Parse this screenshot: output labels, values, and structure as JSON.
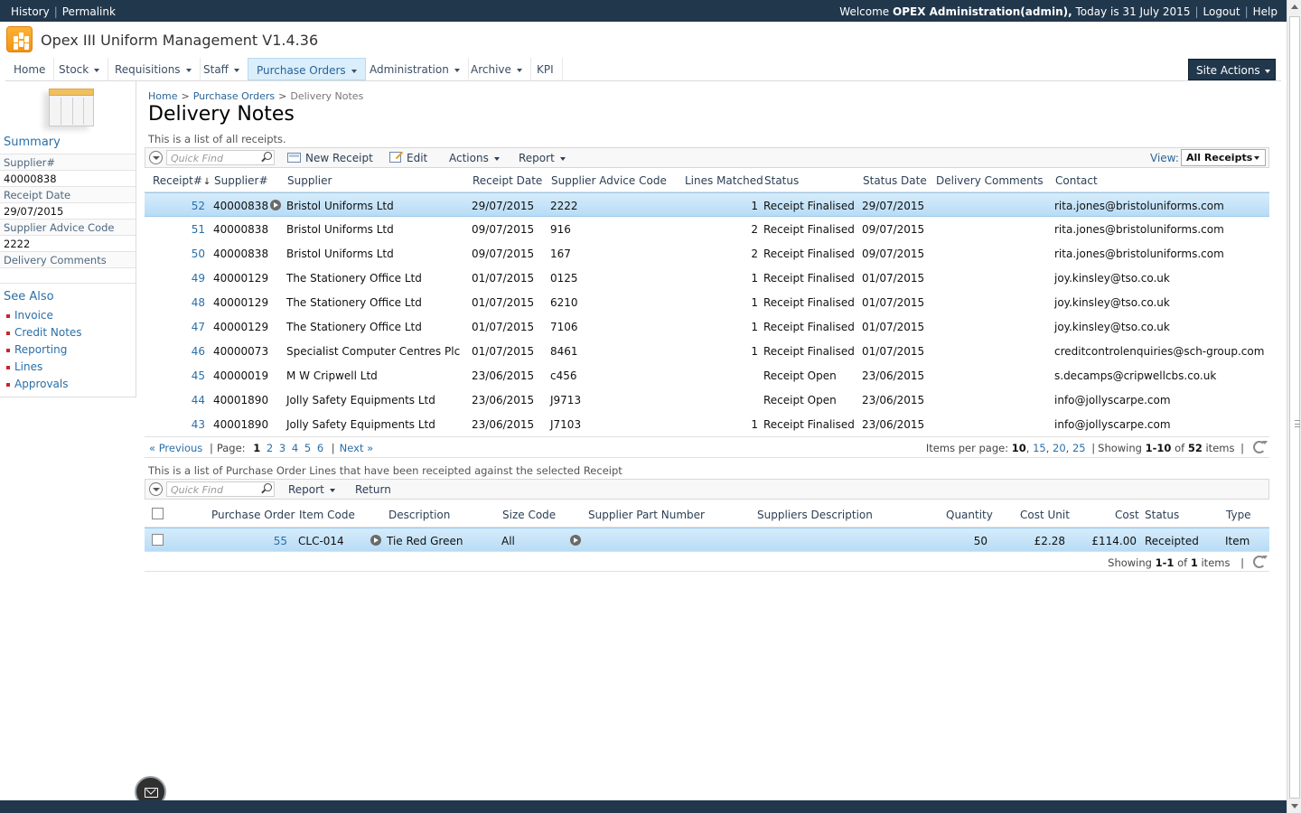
{
  "topbar": {
    "history": "History",
    "permalink": "Permalink",
    "welcome": "Welcome",
    "user": "OPEX Administration(admin),",
    "date_text": "Today is 31 July 2015",
    "logout": "Logout",
    "help": "Help"
  },
  "app": {
    "title": "Opex III Uniform Management V1.4.36"
  },
  "nav": {
    "items": [
      "Home",
      "Stock",
      "Requisitions",
      "Staff",
      "Purchase Orders",
      "Administration",
      "Archive",
      "KPI"
    ],
    "active": "Purchase Orders",
    "site_actions": "Site Actions"
  },
  "breadcrumb": {
    "home": "Home",
    "section": "Purchase Orders",
    "current": "Delivery Notes",
    "sep": ">"
  },
  "page": {
    "title": "Delivery Notes",
    "description": "This is a list of all receipts."
  },
  "summary": {
    "title": "Summary",
    "fields": [
      {
        "label": "Supplier#",
        "value": "40000838"
      },
      {
        "label": "Receipt Date",
        "value": "29/07/2015"
      },
      {
        "label": "Supplier Advice Code",
        "value": "2222"
      },
      {
        "label": "Delivery Comments",
        "value": ""
      }
    ]
  },
  "see_also": {
    "title": "See Also",
    "items": [
      "Invoice",
      "Credit Notes",
      "Reporting",
      "Lines",
      "Approvals"
    ]
  },
  "receipts_toolbar": {
    "quickfind_placeholder": "Quick Find",
    "new_receipt": "New Receipt",
    "edit": "Edit",
    "actions": "Actions",
    "report": "Report",
    "view_label": "View:",
    "view_value": "All Receipts"
  },
  "receipts_columns": [
    "Receipt#",
    "Supplier#",
    "Supplier",
    "Receipt Date",
    "Supplier Advice Code",
    "Lines Matched",
    "Status",
    "Status Date",
    "Delivery Comments",
    "Contact"
  ],
  "receipts_sort_indicator": "↓",
  "receipts": [
    {
      "receipt": "52",
      "supplier_no": "40000838",
      "supplier": "Bristol Uniforms Ltd",
      "date": "29/07/2015",
      "advice": "2222",
      "lines": "1",
      "status": "Receipt Finalised",
      "status_date": "29/07/2015",
      "comments": "",
      "contact": "rita.jones@bristoluniforms.com"
    },
    {
      "receipt": "51",
      "supplier_no": "40000838",
      "supplier": "Bristol Uniforms Ltd",
      "date": "09/07/2015",
      "advice": "916",
      "lines": "2",
      "status": "Receipt Finalised",
      "status_date": "09/07/2015",
      "comments": "",
      "contact": "rita.jones@bristoluniforms.com"
    },
    {
      "receipt": "50",
      "supplier_no": "40000838",
      "supplier": "Bristol Uniforms Ltd",
      "date": "09/07/2015",
      "advice": "167",
      "lines": "2",
      "status": "Receipt Finalised",
      "status_date": "09/07/2015",
      "comments": "",
      "contact": "rita.jones@bristoluniforms.com"
    },
    {
      "receipt": "49",
      "supplier_no": "40000129",
      "supplier": "The Stationery Office Ltd",
      "date": "01/07/2015",
      "advice": "0125",
      "lines": "1",
      "status": "Receipt Finalised",
      "status_date": "01/07/2015",
      "comments": "",
      "contact": "joy.kinsley@tso.co.uk"
    },
    {
      "receipt": "48",
      "supplier_no": "40000129",
      "supplier": "The Stationery Office Ltd",
      "date": "01/07/2015",
      "advice": "6210",
      "lines": "1",
      "status": "Receipt Finalised",
      "status_date": "01/07/2015",
      "comments": "",
      "contact": "joy.kinsley@tso.co.uk"
    },
    {
      "receipt": "47",
      "supplier_no": "40000129",
      "supplier": "The Stationery Office Ltd",
      "date": "01/07/2015",
      "advice": "7106",
      "lines": "1",
      "status": "Receipt Finalised",
      "status_date": "01/07/2015",
      "comments": "",
      "contact": "joy.kinsley@tso.co.uk"
    },
    {
      "receipt": "46",
      "supplier_no": "40000073",
      "supplier": "Specialist Computer Centres Plc",
      "date": "01/07/2015",
      "advice": "8461",
      "lines": "1",
      "status": "Receipt Finalised",
      "status_date": "01/07/2015",
      "comments": "",
      "contact": "creditcontrolenquiries@sch-group.com"
    },
    {
      "receipt": "45",
      "supplier_no": "40000019",
      "supplier": "M W Cripwell Ltd",
      "date": "23/06/2015",
      "advice": "c456",
      "lines": "",
      "status": "Receipt Open",
      "status_date": "23/06/2015",
      "comments": "",
      "contact": "s.decamps@cripwellcbs.co.uk"
    },
    {
      "receipt": "44",
      "supplier_no": "40001890",
      "supplier": "Jolly Safety Equipments Ltd",
      "date": "23/06/2015",
      "advice": "J9713",
      "lines": "",
      "status": "Receipt Open",
      "status_date": "23/06/2015",
      "comments": "",
      "contact": "info@jollyscarpe.com"
    },
    {
      "receipt": "43",
      "supplier_no": "40001890",
      "supplier": "Jolly Safety Equipments Ltd",
      "date": "23/06/2015",
      "advice": "J7103",
      "lines": "1",
      "status": "Receipt Finalised",
      "status_date": "23/06/2015",
      "comments": "",
      "contact": "info@jollyscarpe.com"
    }
  ],
  "receipts_pager": {
    "previous": "« Previous",
    "page_label": "Page:",
    "pages": [
      "1",
      "2",
      "3",
      "4",
      "5",
      "6"
    ],
    "current_page": "1",
    "next": "Next »",
    "items_per_page_label": "Items per page:",
    "sizes": [
      "10",
      "15",
      "20",
      "25"
    ],
    "showing_label": "Showing",
    "range": "1-10",
    "of": "of",
    "total": "52",
    "items": "items"
  },
  "lines": {
    "description": "This is a list of Purchase Order Lines that have been receipted against the selected Receipt",
    "toolbar": {
      "quickfind_placeholder": "Quick Find",
      "report": "Report",
      "return": "Return"
    },
    "columns": [
      "Purchase Order",
      "Item Code",
      "Description",
      "Size Code",
      "Supplier Part Number",
      "Suppliers Description",
      "Quantity",
      "Cost Unit",
      "Cost",
      "Status",
      "Type"
    ],
    "rows": [
      {
        "po": "55",
        "item_code": "CLC-014",
        "description": "Tie Red Green",
        "size": "All",
        "part_no": "",
        "supp_desc": "",
        "quantity": "50",
        "cost_unit": "£2.28",
        "cost": "£114.00",
        "status": "Receipted",
        "type": "Item"
      }
    ],
    "pager": {
      "showing_label": "Showing",
      "range": "1-1",
      "of": "of",
      "total": "1",
      "items": "items"
    }
  }
}
